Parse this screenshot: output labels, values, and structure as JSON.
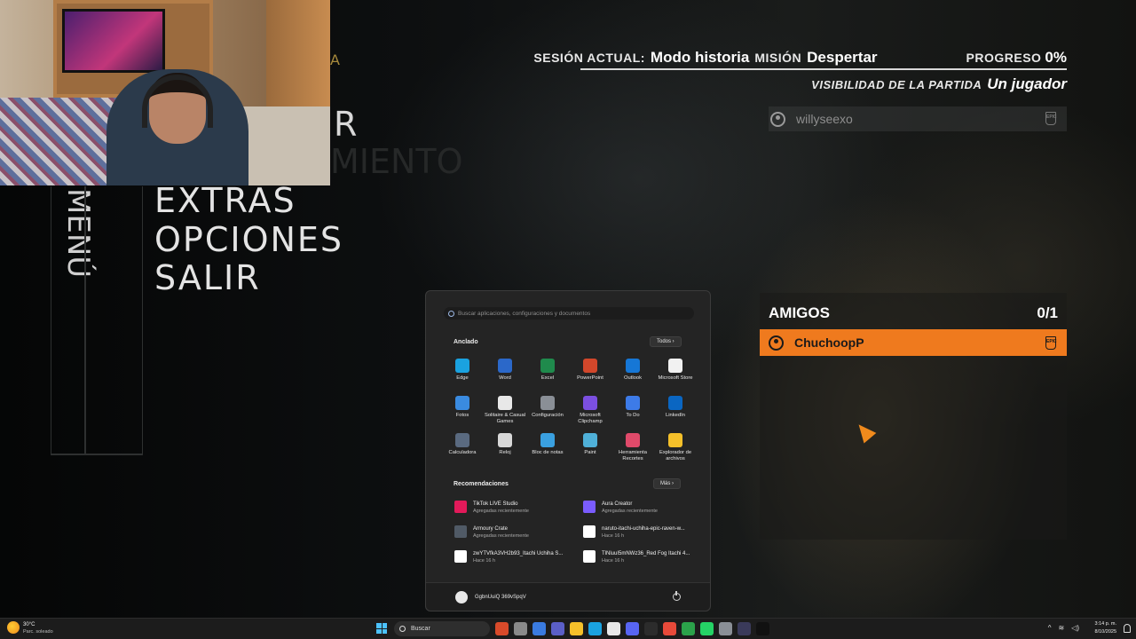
{
  "game_menu": {
    "rotated_label": "MENÚ",
    "ghost_letter_1": "A",
    "ghost_letter_2": "R",
    "ghost_word": "MIENTO",
    "items": [
      "EXTRAS",
      "OPCIONES",
      "SALIR"
    ]
  },
  "hud": {
    "session_label": "SESIÓN ACTUAL:",
    "session_value": "Modo historia",
    "mission_label": "MISIÓN",
    "mission_value": "Despertar",
    "progress_label": "PROGRESO",
    "progress_value": "0%",
    "visibility_label": "VISIBILIDAD DE LA PARTIDA",
    "visibility_value": "Un jugador",
    "player_name": "willyseexo",
    "epic_icon_text": "EPIC"
  },
  "friends": {
    "title": "AMIGOS",
    "count": "0/1",
    "list": [
      {
        "name": "ChuchoopP"
      }
    ]
  },
  "start_menu": {
    "search_placeholder": "Buscar aplicaciones, configuraciones y documentos",
    "pinned_title": "Anclado",
    "all_button": "Todos  ›",
    "pinned": [
      {
        "name": "Edge",
        "color": "#1aa2e0"
      },
      {
        "name": "Word",
        "color": "#2b68c9"
      },
      {
        "name": "Excel",
        "color": "#1f8a4c"
      },
      {
        "name": "PowerPoint",
        "color": "#d2472b"
      },
      {
        "name": "Outlook",
        "color": "#1677d6"
      },
      {
        "name": "Microsoft Store",
        "color": "#f1f1f1"
      },
      {
        "name": "Fotos",
        "color": "#3a8be0"
      },
      {
        "name": "Solitaire & Casual Games",
        "color": "#e8e8e8"
      },
      {
        "name": "Configuración",
        "color": "#8a8f96"
      },
      {
        "name": "Microsoft Clipchamp",
        "color": "#7b4fe0"
      },
      {
        "name": "To Do",
        "color": "#3d7be8"
      },
      {
        "name": "LinkedIn",
        "color": "#0a66c2"
      },
      {
        "name": "Calculadora",
        "color": "#5a6a80"
      },
      {
        "name": "Reloj",
        "color": "#d8d8d8"
      },
      {
        "name": "Bloc de notas",
        "color": "#3aa0e0"
      },
      {
        "name": "Paint",
        "color": "#4fb0d8"
      },
      {
        "name": "Herramienta Recortes",
        "color": "#e04a6a"
      },
      {
        "name": "Explorador de archivos",
        "color": "#f5c02a"
      }
    ],
    "recommended_title": "Recomendaciones",
    "more_button": "Más  ›",
    "recommended": [
      {
        "name": "TikTok LIVE Studio",
        "sub": "Agregadas recientemente",
        "color": "#e21a5a"
      },
      {
        "name": "Aura Creator",
        "sub": "Agregadas recientemente",
        "color": "#7a5cff"
      },
      {
        "name": "Armoury Crate",
        "sub": "Agregadas recientemente",
        "color": "#505a66"
      },
      {
        "name": "naruto-itachi-uchiha-epic-raven-w...",
        "sub": "Hace 16 h",
        "color": "#ffffff"
      },
      {
        "name": "zwYTVfkA3VH2b93_Itachi Uchiha S...",
        "sub": "Hace 16 h",
        "color": "#ffffff"
      },
      {
        "name": "TlNluuI5mNWz36_Red Fog Itachi 4...",
        "sub": "Hace 16 h",
        "color": "#ffffff"
      }
    ],
    "user_name": "GgbnUuiQ 369vSpqV"
  },
  "taskbar": {
    "weather_temp": "30°C",
    "weather_condition": "Parc. soleado",
    "search_label": "Buscar",
    "time": "3:14 p. m.",
    "date": "8/10/2025",
    "icons": [
      {
        "name": "copilot-icon",
        "color": "#d84a2a"
      },
      {
        "name": "task-view-icon",
        "color": "#8a8a8a"
      },
      {
        "name": "copilot-app-icon",
        "color": "#3a7be0"
      },
      {
        "name": "teams-icon",
        "color": "#5b5fc7"
      },
      {
        "name": "file-explorer-icon",
        "color": "#f5c02a"
      },
      {
        "name": "edge-icon",
        "color": "#1aa2e0"
      },
      {
        "name": "store-icon",
        "color": "#e8e8e8"
      },
      {
        "name": "discord-icon",
        "color": "#5865f2"
      },
      {
        "name": "epic-games-icon",
        "color": "#2c2c2c"
      },
      {
        "name": "chrome-icon",
        "color": "#e84a3a"
      },
      {
        "name": "xbox-icon",
        "color": "#2ba24a"
      },
      {
        "name": "whatsapp-icon",
        "color": "#25d366"
      },
      {
        "name": "settings-icon",
        "color": "#8a8f96"
      },
      {
        "name": "obs-icon",
        "color": "#3a3a5a"
      },
      {
        "name": "dying-light-icon",
        "color": "#111111"
      }
    ]
  },
  "colors": {
    "accent_orange": "#ef7a1e",
    "windows_blue": "#4cc2ff"
  }
}
